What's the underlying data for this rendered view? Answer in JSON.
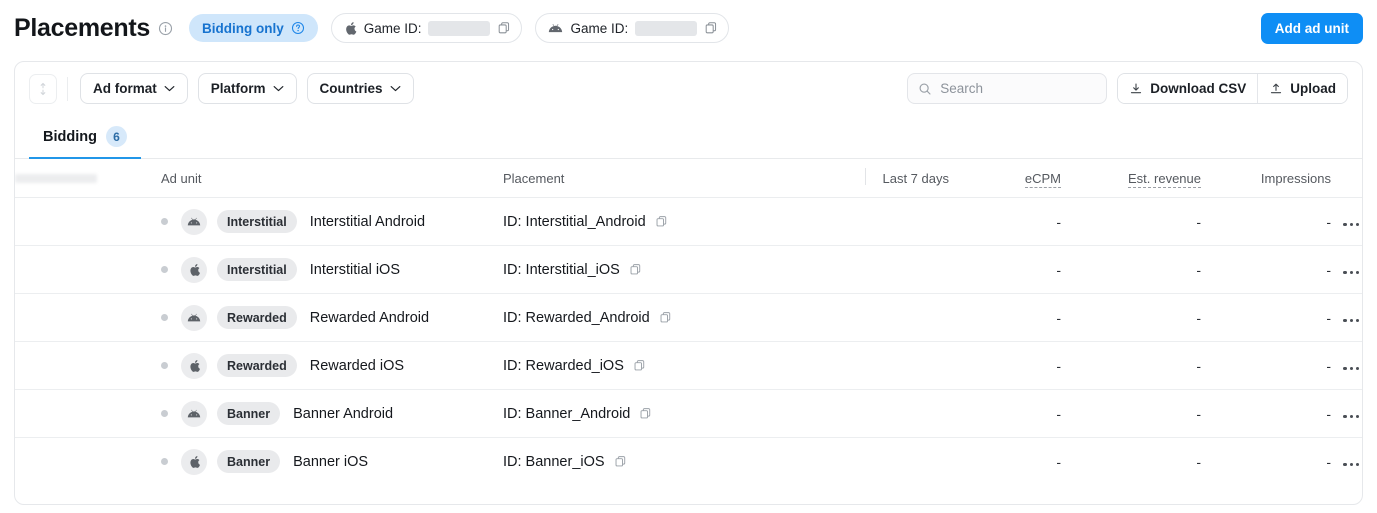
{
  "header": {
    "title": "Placements",
    "info_icon": "info-icon",
    "bidding_pill": {
      "label": "Bidding only",
      "help_icon": "help-circle-icon"
    },
    "game_ids": [
      {
        "platform": "ios",
        "platform_icon": "apple-icon",
        "label": "Game ID:",
        "value": "",
        "copy_icon": "copy-icon"
      },
      {
        "platform": "android",
        "platform_icon": "android-icon",
        "label": "Game ID:",
        "value": "",
        "copy_icon": "copy-icon"
      }
    ],
    "add_ad_unit_label": "Add ad unit",
    "accent_color": "#0e8ef5"
  },
  "toolbar": {
    "reorder_icon": "sort-vertical-icon",
    "filters": [
      {
        "label": "Ad format",
        "icon": "chevron-down-icon"
      },
      {
        "label": "Platform",
        "icon": "chevron-down-icon"
      },
      {
        "label": "Countries",
        "icon": "chevron-down-icon"
      }
    ],
    "search": {
      "placeholder": "Search",
      "value": "",
      "icon": "search-icon"
    },
    "download_csv": {
      "label": "Download CSV",
      "icon": "download-icon"
    },
    "upload": {
      "label": "Upload",
      "icon": "upload-icon"
    }
  },
  "tabs": [
    {
      "label": "Bidding",
      "badge": "6",
      "active": true
    }
  ],
  "table": {
    "columns": {
      "redacted": "",
      "ad_unit": "Ad unit",
      "placement": "Placement",
      "last_7_days": "Last 7 days",
      "ecpm": "eCPM",
      "est_revenue": "Est. revenue",
      "impressions": "Impressions"
    },
    "rows": [
      {
        "status": "inactive",
        "platform": "android",
        "platform_icon": "android-icon",
        "format": "Interstitial",
        "name": "Interstitial Android",
        "placement": "ID: Interstitial_Android",
        "copy_icon": "copy-icon",
        "ecpm": "-",
        "est_revenue": "-",
        "impressions": "-",
        "menu_icon": "kebab-menu-icon"
      },
      {
        "status": "inactive",
        "platform": "ios",
        "platform_icon": "apple-icon",
        "format": "Interstitial",
        "name": "Interstitial iOS",
        "placement": "ID: Interstitial_iOS",
        "copy_icon": "copy-icon",
        "ecpm": "-",
        "est_revenue": "-",
        "impressions": "-",
        "menu_icon": "kebab-menu-icon"
      },
      {
        "status": "inactive",
        "platform": "android",
        "platform_icon": "android-icon",
        "format": "Rewarded",
        "name": "Rewarded Android",
        "placement": "ID: Rewarded_Android",
        "copy_icon": "copy-icon",
        "ecpm": "-",
        "est_revenue": "-",
        "impressions": "-",
        "menu_icon": "kebab-menu-icon"
      },
      {
        "status": "inactive",
        "platform": "ios",
        "platform_icon": "apple-icon",
        "format": "Rewarded",
        "name": "Rewarded iOS",
        "placement": "ID: Rewarded_iOS",
        "copy_icon": "copy-icon",
        "ecpm": "-",
        "est_revenue": "-",
        "impressions": "-",
        "menu_icon": "kebab-menu-icon"
      },
      {
        "status": "inactive",
        "platform": "android",
        "platform_icon": "android-icon",
        "format": "Banner",
        "name": "Banner Android",
        "placement": "ID: Banner_Android",
        "copy_icon": "copy-icon",
        "ecpm": "-",
        "est_revenue": "-",
        "impressions": "-",
        "menu_icon": "kebab-menu-icon"
      },
      {
        "status": "inactive",
        "platform": "ios",
        "platform_icon": "apple-icon",
        "format": "Banner",
        "name": "Banner iOS",
        "placement": "ID: Banner_iOS",
        "copy_icon": "copy-icon",
        "ecpm": "-",
        "est_revenue": "-",
        "impressions": "-",
        "menu_icon": "kebab-menu-icon"
      }
    ]
  }
}
